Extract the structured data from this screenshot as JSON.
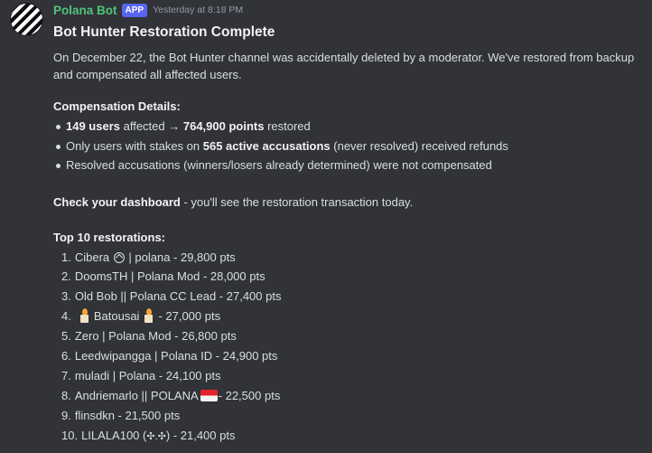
{
  "message": {
    "author": "Polana Bot",
    "badge": "APP",
    "timestamp": "Yesterday at 8:18 PM",
    "title": "Bot Hunter Restoration Complete",
    "intro": "On December 22, the Bot Hunter channel was accidentally deleted by a moderator. We've restored from backup and compensated all affected users.",
    "compensation_heading": "Compensation Details:",
    "bullet1": {
      "users": "149 users",
      "affected": " affected → ",
      "points": "764,900 points",
      "restored": " restored"
    },
    "bullet2": {
      "pre": "Only users with stakes on ",
      "accusations": "565 active accusations",
      "post": " (never resolved) received refunds"
    },
    "bullet3": "Resolved accusations (winners/losers already determined) were not compensated",
    "check_bold": "Check your dashboard",
    "check_rest": " - you'll see the restoration transaction today.",
    "top_heading": "Top 10 restorations:",
    "restorations": [
      {
        "num": "1.",
        "pre": "Cibera",
        "post": "| polana - 29,800 pts"
      },
      {
        "num": "2.",
        "text": "DoomsTH | Polana Mod - 28,000 pts"
      },
      {
        "num": "3.",
        "text": "Old Bob || Polana CC Lead - 27,400 pts"
      },
      {
        "num": "4.",
        "name": "Batousai",
        "post": "- 27,000 pts"
      },
      {
        "num": "5.",
        "text": "Zero | Polana Mod - 26,800 pts"
      },
      {
        "num": "6.",
        "text": "Leedwipangga | Polana ID - 24,900 pts"
      },
      {
        "num": "7.",
        "text": "muladi | Polana - 24,100 pts"
      },
      {
        "num": "8.",
        "pre": "Andriemarlo || POLANA",
        "post": "- 22,500 pts"
      },
      {
        "num": "9.",
        "text": "flinsdkn - 21,500 pts"
      },
      {
        "num": "10.",
        "pre": "LILALA100 (",
        "sparkle": "✣.✣",
        "post": ") - 21,400 pts"
      }
    ]
  },
  "icons": {
    "avatar": "striped-avatar",
    "row1": "recycle-icon",
    "row4": "candle-icon",
    "row8": "indonesia-flag-icon"
  }
}
